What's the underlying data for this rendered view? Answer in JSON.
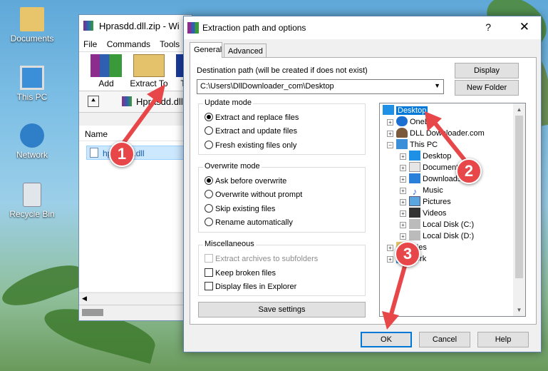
{
  "desktop": {
    "icons": [
      {
        "label": "Documents"
      },
      {
        "label": "This PC"
      },
      {
        "label": "Network"
      },
      {
        "label": "Recycle Bin"
      }
    ]
  },
  "bg_window": {
    "title": "Hprasdd.dll.zip - Wi",
    "menu": [
      "File",
      "Commands",
      "Tools"
    ],
    "toolbar": {
      "add": "Add",
      "extract_to": "Extract To",
      "test": "T"
    },
    "path": "Hprasdd.dll.zip",
    "list_header": "Name",
    "selected_file": "hprasdd.dll"
  },
  "dialog": {
    "title": "Extraction path and options",
    "help_glyph": "?",
    "close_glyph": "✕",
    "tabs": [
      "General",
      "Advanced"
    ],
    "destination_label": "Destination path (will be created if does not exist)",
    "destination_value": "C:\\Users\\DllDownloader_com\\Desktop",
    "display_button": "Display",
    "new_folder_button": "New Folder",
    "update_mode": {
      "label": "Update mode",
      "options": [
        "Extract and replace files",
        "Extract and update files",
        "Fresh existing files only"
      ],
      "selected": 0
    },
    "overwrite_mode": {
      "label": "Overwrite mode",
      "options": [
        "Ask before overwrite",
        "Overwrite without prompt",
        "Skip existing files",
        "Rename automatically"
      ],
      "selected": 0
    },
    "misc": {
      "label": "Miscellaneous",
      "options": [
        "Extract archives to subfolders",
        "Keep broken files",
        "Display files in Explorer"
      ]
    },
    "save_settings": "Save settings",
    "tree": [
      "Desktop",
      "OneDr",
      "DLL Downloader.com",
      "This PC",
      "Desktop",
      "Documents",
      "Downloads",
      "Music",
      "Pictures",
      "Videos",
      "Local Disk (C:)",
      "Local Disk (D:)",
      "aries",
      "work"
    ],
    "ok": "OK",
    "cancel": "Cancel",
    "help": "Help"
  },
  "annotations": {
    "step1": "1",
    "step2": "2",
    "step3": "3",
    "color": "#e8474a"
  }
}
